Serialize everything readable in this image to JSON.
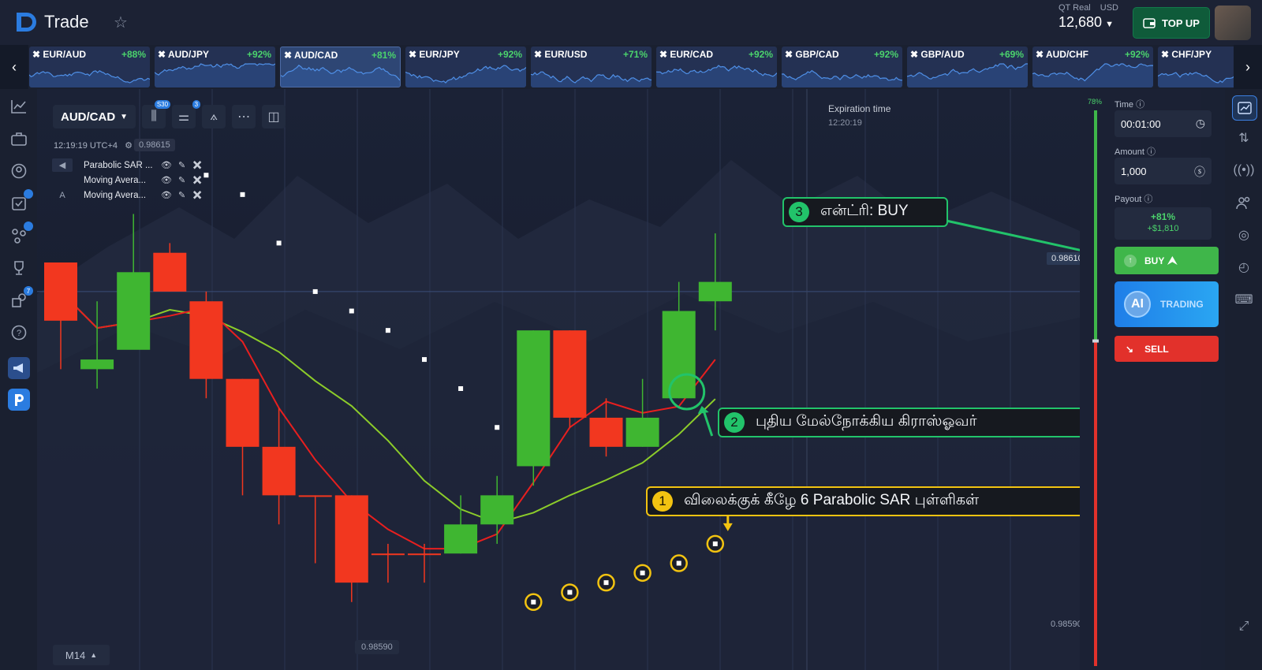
{
  "header": {
    "logo_text": "Trade",
    "account_type": "QT Real",
    "currency": "USD",
    "balance": "12,680",
    "topup_label": "TOP UP"
  },
  "tickers": [
    {
      "name": "EUR/AUD",
      "payout": "+88%"
    },
    {
      "name": "AUD/JPY",
      "payout": "+92%"
    },
    {
      "name": "AUD/CAD",
      "payout": "+81%"
    },
    {
      "name": "EUR/JPY",
      "payout": "+92%"
    },
    {
      "name": "EUR/USD",
      "payout": "+71%"
    },
    {
      "name": "EUR/CAD",
      "payout": "+92%"
    },
    {
      "name": "GBP/CAD",
      "payout": "+92%"
    },
    {
      "name": "GBP/AUD",
      "payout": "+69%"
    },
    {
      "name": "AUD/CHF",
      "payout": "+92%"
    },
    {
      "name": "CHF/JPY",
      "payout": ""
    }
  ],
  "left_nav_badges": {
    "trade": "",
    "social": "",
    "notify": "7"
  },
  "toolbar": {
    "pair": "AUD/CAD",
    "candle_badge": "S30",
    "indicator_badge": "3"
  },
  "chart_info": {
    "clock": "12:19:19 UTC+4",
    "top_price": "0.98615",
    "expiration_label": "Expiration time",
    "expiration_time": "12:20:19",
    "current_price": "0.98610",
    "low_price": "0.98590",
    "bottom_price": "0.98590",
    "timeframe": "M14"
  },
  "indicators": [
    {
      "lead": "",
      "name": "Parabolic SAR ..."
    },
    {
      "lead": "",
      "name": "Moving Avera..."
    },
    {
      "lead": "A",
      "name": "Moving Avera..."
    }
  ],
  "callouts": {
    "c1_num": "1",
    "c1_text": "விலைக்குக் கீழே 6 Parabolic SAR புள்ளிகள்",
    "c2_num": "2",
    "c2_text": "புதிய மேல்நோக்கிய கிராஸ்ஓவர்",
    "c3_num": "3",
    "c3_text": "என்ட்ரி: BUY"
  },
  "trade_panel": {
    "meter_pct": "78%",
    "time_label": "Time",
    "time_value": "00:01:00",
    "amount_label": "Amount",
    "amount_value": "1,000",
    "payout_label": "Payout",
    "payout_pct": "+81%",
    "payout_amount": "+$1,810",
    "buy_label": "BUY",
    "ai_logo": "AI",
    "ai_label": "TRADING",
    "sell_label": "SELL"
  },
  "colors": {
    "bull": "#3fb631",
    "bear": "#f2371f",
    "ma_fast": "#e81f1f",
    "ma_slow": "#8ccc2a"
  },
  "chart_data": {
    "type": "candlestick",
    "candles": [
      {
        "o": 0.98613,
        "h": 0.98613,
        "l": 0.98602,
        "c": 0.98607,
        "dir": "bear"
      },
      {
        "o": 0.98602,
        "h": 0.98609,
        "l": 0.986,
        "c": 0.98603,
        "dir": "bull"
      },
      {
        "o": 0.98612,
        "h": 0.98618,
        "l": 0.9861,
        "c": 0.98604,
        "dir": "bull"
      },
      {
        "o": 0.98614,
        "h": 0.98615,
        "l": 0.9861,
        "c": 0.9861,
        "dir": "bear"
      },
      {
        "o": 0.98609,
        "h": 0.9861,
        "l": 0.98599,
        "c": 0.98601,
        "dir": "bear"
      },
      {
        "o": 0.98601,
        "h": 0.98601,
        "l": 0.98589,
        "c": 0.98594,
        "dir": "bear"
      },
      {
        "o": 0.98594,
        "h": 0.98598,
        "l": 0.98586,
        "c": 0.98589,
        "dir": "bear"
      },
      {
        "o": 0.98589,
        "h": 0.98589,
        "l": 0.98582,
        "c": 0.98589,
        "dir": "bear"
      },
      {
        "o": 0.98589,
        "h": 0.98589,
        "l": 0.98578,
        "c": 0.9858,
        "dir": "bear"
      },
      {
        "o": 0.98583,
        "h": 0.98584,
        "l": 0.9858,
        "c": 0.98583,
        "dir": "bear"
      },
      {
        "o": 0.98583,
        "h": 0.98584,
        "l": 0.9858,
        "c": 0.98583,
        "dir": "bear"
      },
      {
        "o": 0.98583,
        "h": 0.98589,
        "l": 0.98583,
        "c": 0.98586,
        "dir": "bull"
      },
      {
        "o": 0.98586,
        "h": 0.98591,
        "l": 0.98584,
        "c": 0.98589,
        "dir": "bull"
      },
      {
        "o": 0.98592,
        "h": 0.98606,
        "l": 0.9859,
        "c": 0.98606,
        "dir": "bull"
      },
      {
        "o": 0.98606,
        "h": 0.98606,
        "l": 0.98596,
        "c": 0.98597,
        "dir": "bear"
      },
      {
        "o": 0.98597,
        "h": 0.98599,
        "l": 0.98593,
        "c": 0.98594,
        "dir": "bear"
      },
      {
        "o": 0.98594,
        "h": 0.98601,
        "l": 0.98594,
        "c": 0.98597,
        "dir": "bull"
      },
      {
        "o": 0.98599,
        "h": 0.98611,
        "l": 0.98599,
        "c": 0.98608,
        "dir": "bull"
      },
      {
        "o": 0.98609,
        "h": 0.98616,
        "l": 0.98606,
        "c": 0.98611,
        "dir": "bull"
      }
    ],
    "parabolic_sar": [
      0.98622,
      0.9862,
      0.98615,
      0.9861,
      0.98608,
      0.98606,
      0.98603,
      0.986,
      0.98596,
      0.98578,
      0.98579,
      0.9858,
      0.98581,
      0.98582,
      0.98584
    ],
    "ylim": [
      0.98574,
      0.98626
    ]
  }
}
